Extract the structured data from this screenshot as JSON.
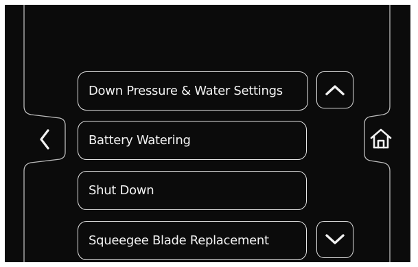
{
  "menu": {
    "items": [
      {
        "label": "Down Pressure & Water Settings"
      },
      {
        "label": "Battery Watering"
      },
      {
        "label": "Shut Down"
      },
      {
        "label": "Squeegee Blade Replacement"
      }
    ]
  },
  "navigation": {
    "back_icon": "chevron-left-icon",
    "home_icon": "home-icon",
    "scroll_up_icon": "chevron-up-icon",
    "scroll_down_icon": "chevron-down-icon"
  },
  "colors": {
    "background": "#0b0b0b",
    "foreground": "#e6e6e6"
  }
}
